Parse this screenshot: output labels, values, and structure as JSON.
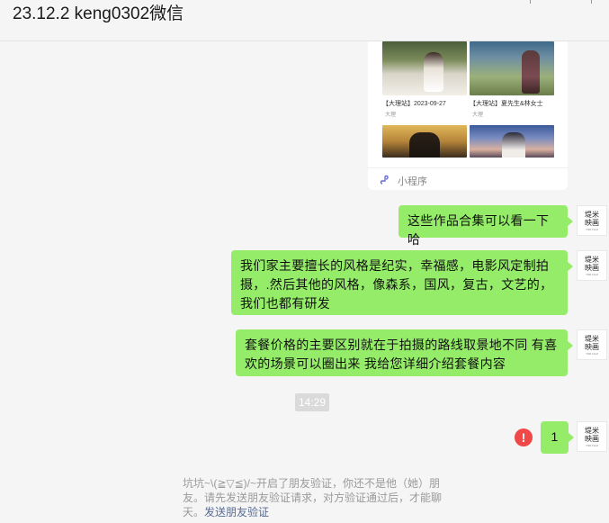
{
  "window": {
    "title": "23.12.2 keng0302微信"
  },
  "mini_program_card": {
    "items": [
      {
        "caption": "【大理站】2023-09-27",
        "sub": "大理"
      },
      {
        "caption": "【大理站】夏先生&林女士",
        "sub": "大理"
      }
    ],
    "footer_label": "小程序"
  },
  "messages": [
    {
      "text": "这些作品合集可以看一下哈"
    },
    {
      "text": "我们家主要擅长的风格是纪实，幸福感，电影风定制拍摄，.然后其他的风格，像森系，国风，复古，文艺的，我们也都有研发"
    },
    {
      "text": "套餐价格的主要区别就在于拍摄的路线取景地不同   有喜欢的场景可以圈出来  我给您详细介绍套餐内容"
    },
    {
      "text": "1"
    }
  ],
  "avatar": {
    "text": "堤米映画",
    "subtext": "TIMI FILM"
  },
  "timestamp": "14:29",
  "error_icon": "!",
  "system_note": {
    "text": "坑坑~\\(≧▽≦)/~开启了朋友验证，你还不是他（她）朋友。请先发送朋友验证请求，对方验证通过后，才能聊天。",
    "link": "发送朋友验证"
  },
  "colors": {
    "bubble": "#95ec69",
    "background": "#f5f5f5",
    "link": "#576b95",
    "error": "#f04848"
  }
}
